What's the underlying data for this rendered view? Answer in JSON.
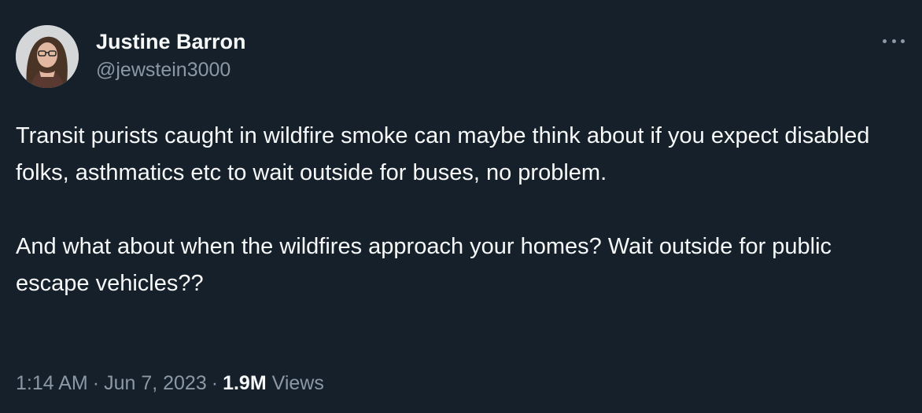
{
  "author": {
    "display_name": "Justine Barron",
    "handle": "@jewstein3000"
  },
  "tweet": {
    "paragraphs": [
      "Transit purists caught in wildfire smoke can maybe think about if you expect disabled folks, asthmatics etc to wait outside for buses, no problem.",
      "And what about when the wildfires approach your homes? Wait outside for public escape vehicles??"
    ]
  },
  "meta": {
    "time": "1:14 AM",
    "separator": "·",
    "date": "Jun 7, 2023",
    "views_count": "1.9M",
    "views_label": "Views"
  },
  "icons": {
    "more": "more-horizontal-icon"
  },
  "colors": {
    "background": "#15202b",
    "primary_text": "#f7f9f9",
    "secondary_text": "#8b98a5"
  }
}
